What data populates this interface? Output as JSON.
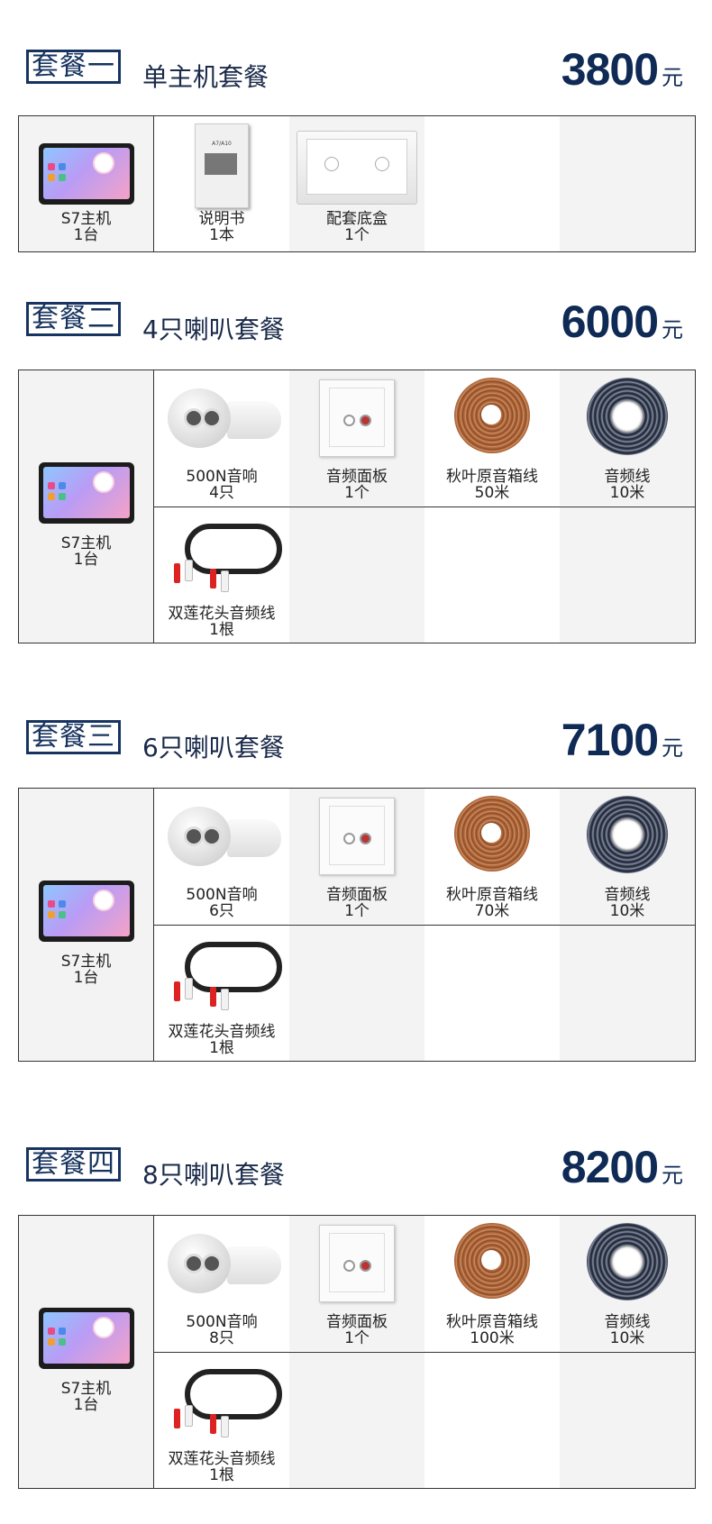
{
  "currency": "元",
  "packages": [
    {
      "tag": "套餐一",
      "title": "单主机套餐",
      "price": "3800",
      "host": {
        "name": "S7主机",
        "qty": "1台"
      },
      "row1": [
        {
          "name": "说明书",
          "qty": "1本",
          "icon": "manual-icon"
        },
        {
          "name": "配套底盒",
          "qty": "1个",
          "icon": "backbox-icon"
        }
      ]
    },
    {
      "tag": "套餐二",
      "title": "4只喇叭套餐",
      "price": "6000",
      "host": {
        "name": "S7主机",
        "qty": "1台"
      },
      "row1": [
        {
          "name": "500N音响",
          "qty": "4只",
          "icon": "speaker-icon"
        },
        {
          "name": "音频面板",
          "qty": "1个",
          "icon": "audio-panel-icon"
        },
        {
          "name": "秋叶原音箱线",
          "qty": "50米",
          "icon": "speaker-cable-icon"
        },
        {
          "name": "音频线",
          "qty": "10米",
          "icon": "audio-cable-icon"
        }
      ],
      "row2": [
        {
          "name": "双莲花头音频线",
          "qty": "1根",
          "icon": "rca-cable-icon"
        }
      ]
    },
    {
      "tag": "套餐三",
      "title": "6只喇叭套餐",
      "price": "7100",
      "host": {
        "name": "S7主机",
        "qty": "1台"
      },
      "row1": [
        {
          "name": "500N音响",
          "qty": "6只",
          "icon": "speaker-icon"
        },
        {
          "name": "音频面板",
          "qty": "1个",
          "icon": "audio-panel-icon"
        },
        {
          "name": "秋叶原音箱线",
          "qty": "70米",
          "icon": "speaker-cable-icon"
        },
        {
          "name": "音频线",
          "qty": "10米",
          "icon": "audio-cable-icon"
        }
      ],
      "row2": [
        {
          "name": "双莲花头音频线",
          "qty": "1根",
          "icon": "rca-cable-icon"
        }
      ]
    },
    {
      "tag": "套餐四",
      "title": "8只喇叭套餐",
      "price": "8200",
      "host": {
        "name": "S7主机",
        "qty": "1台"
      },
      "row1": [
        {
          "name": "500N音响",
          "qty": "8只",
          "icon": "speaker-icon"
        },
        {
          "name": "音频面板",
          "qty": "1个",
          "icon": "audio-panel-icon"
        },
        {
          "name": "秋叶原音箱线",
          "qty": "100米",
          "icon": "speaker-cable-icon"
        },
        {
          "name": "音频线",
          "qty": "10米",
          "icon": "audio-cable-icon"
        }
      ],
      "row2": [
        {
          "name": "双莲花头音频线",
          "qty": "1根",
          "icon": "rca-cable-icon"
        }
      ]
    }
  ]
}
